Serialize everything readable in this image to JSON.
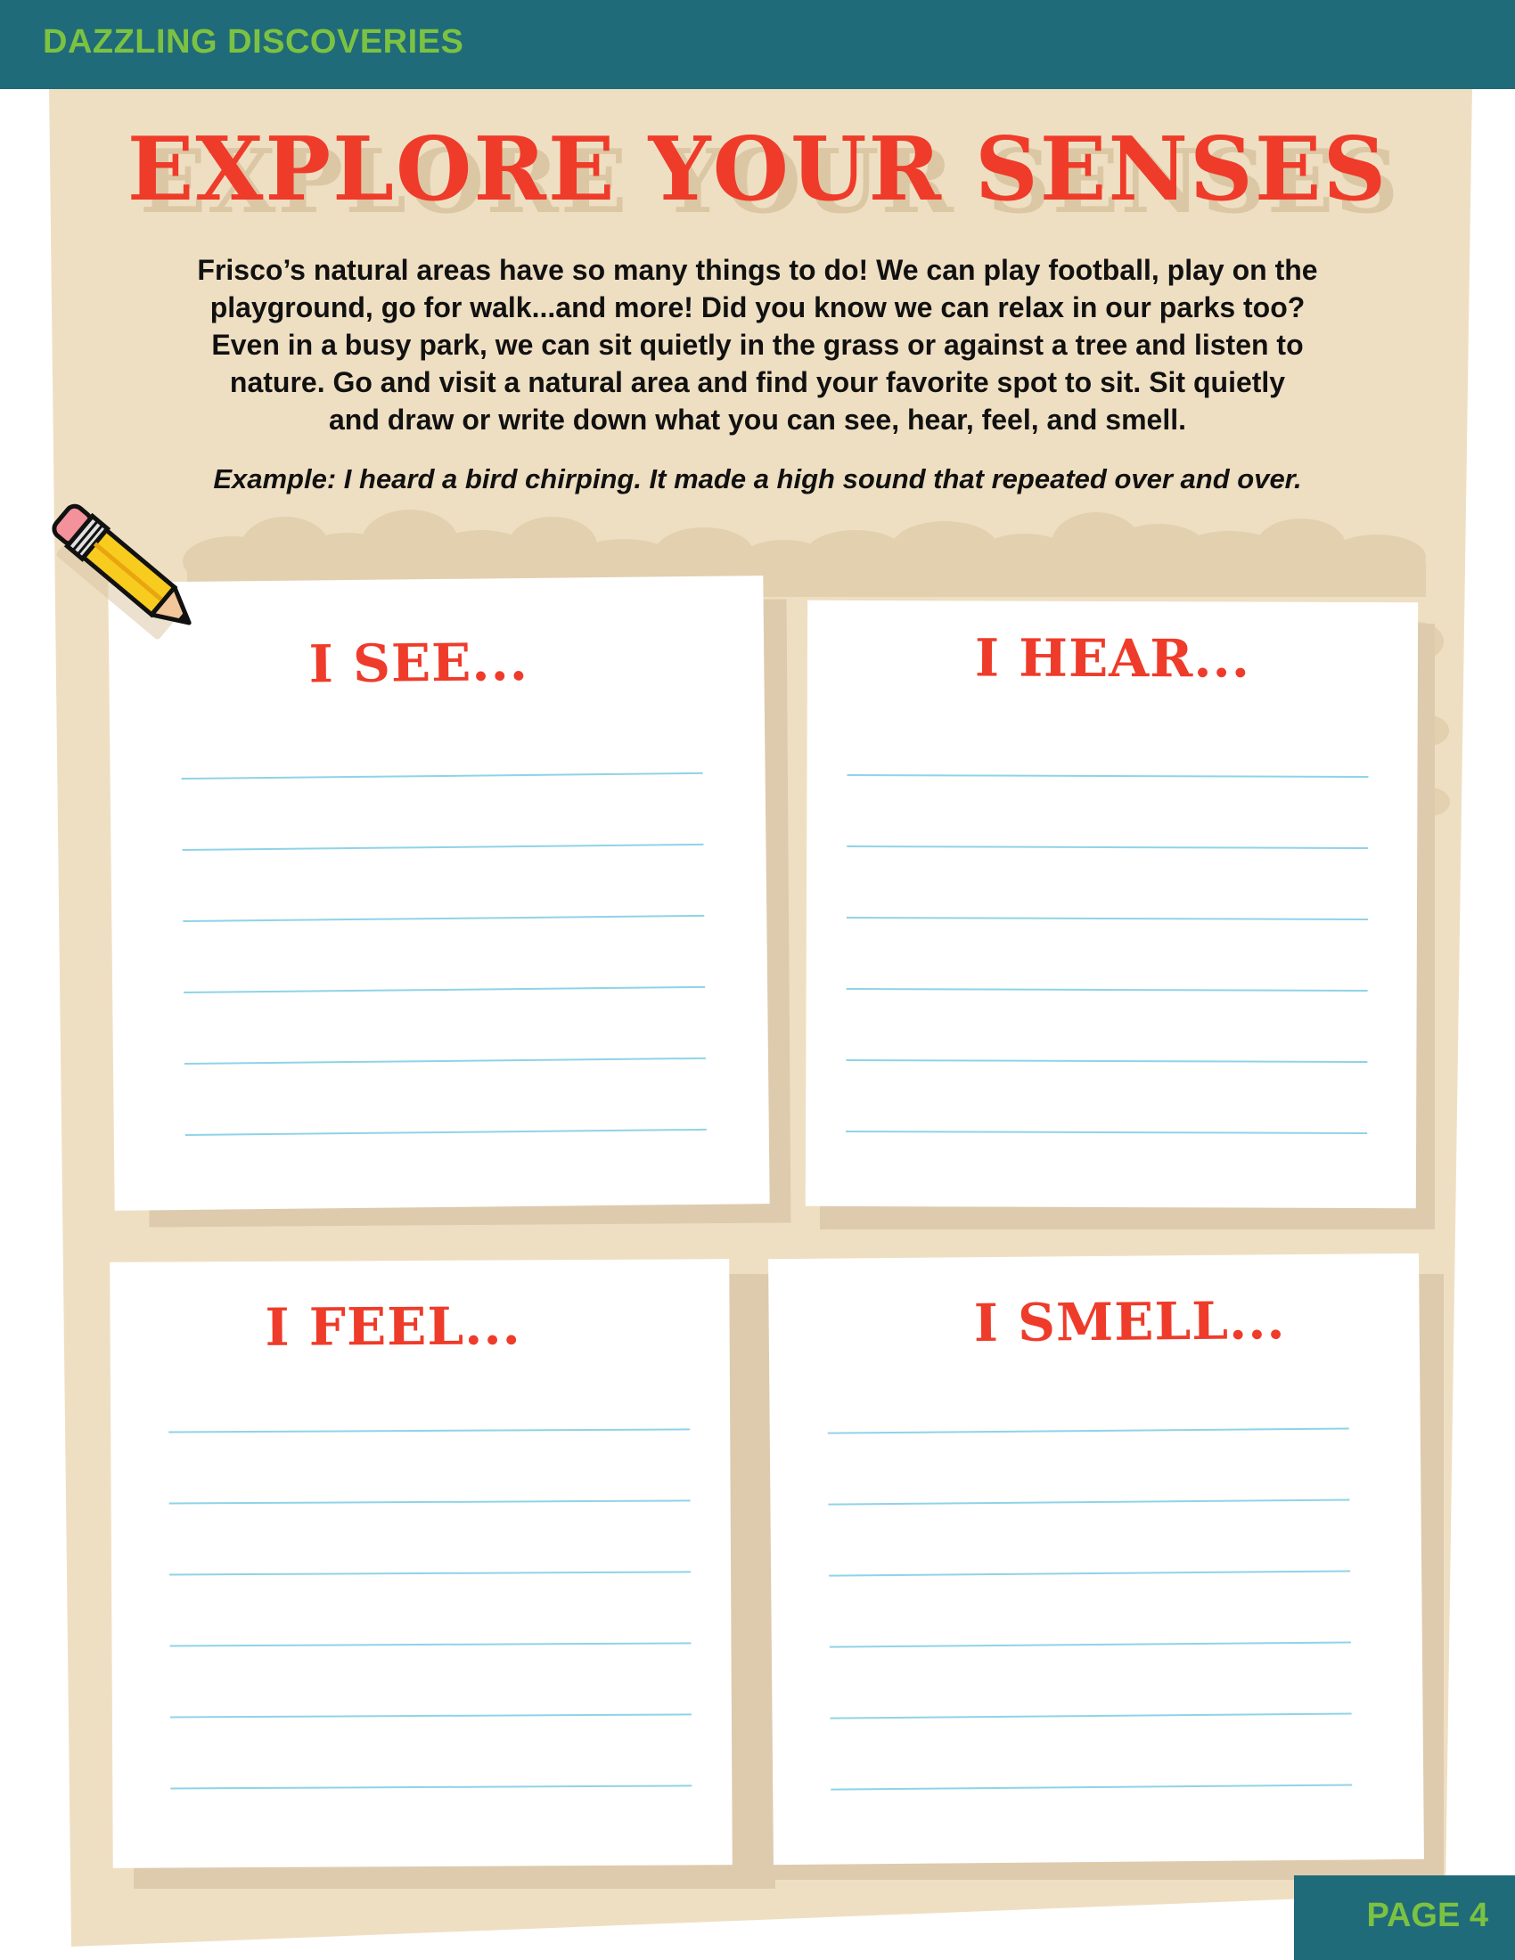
{
  "header": {
    "title": "DAZZLING DISCOVERIES"
  },
  "main": {
    "title": "EXPLORE YOUR SENSES",
    "intro_lines": [
      "Frisco’s natural areas have so many things to do! We can play football, play on the",
      "playground, go for walk...and more! Did you know we can relax in our parks too?",
      "Even in a busy park, we can sit quietly in the grass or against a tree and listen to",
      "nature. Go and visit a natural area and find your favorite spot to sit. Sit quietly",
      "and draw or write down what you can see, hear, feel, and smell."
    ],
    "example": "Example: I heard a bird chirping. It made a high sound that repeated over and over."
  },
  "cards": {
    "see": {
      "title": "I SEE..."
    },
    "hear": {
      "title": "I HEAR..."
    },
    "feel": {
      "title": "I FEEL..."
    },
    "smell": {
      "title": "I SMELL..."
    }
  },
  "footer": {
    "page": "PAGE 4"
  },
  "colors": {
    "header": "#1f6b7a",
    "header_text": "#7cc242",
    "title_red": "#ef3b2a",
    "tan": "#efdfc2",
    "line_blue": "#8fd3e8"
  },
  "icons": {
    "pencil": "pencil-icon",
    "bushes": "bushes-silhouette"
  }
}
